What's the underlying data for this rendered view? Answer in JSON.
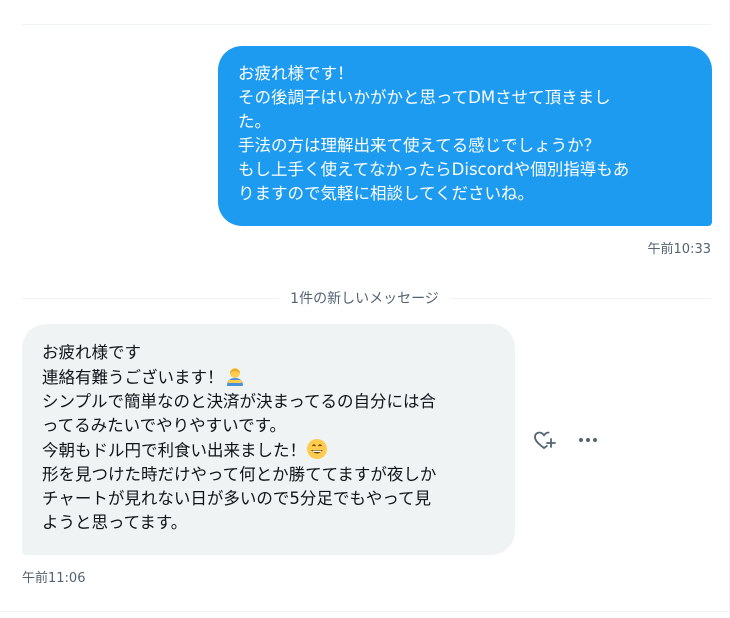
{
  "sent_message": {
    "lines": [
      "お疲れ様です！",
      "その後調子はいかがかと思ってDMさせて頂きまし",
      "た。",
      "手法の方は理解出来て使えてる感じでしょうか？",
      "もし上手く使えてなかったらDiscordや個別指導もあ",
      "りますので気軽に相談してくださいね。"
    ],
    "timestamp": "午前10:33"
  },
  "new_messages_label": "1件の新しいメッセージ",
  "received_message": {
    "line1": "お疲れ様です",
    "line2": "連絡有難うございます！",
    "line3": "シンプルで簡単なのと決済が決まってるの自分には合",
    "line4": "ってるみたいでやりやすいです。",
    "line5": "今朝もドル円で利食い出来ました！",
    "line6": "形を見つけた時だけやって何とか勝ててますが夜しか",
    "line7": "チャートが見れない日が多いので5分足でもやって見",
    "line8": "ようと思ってます。",
    "emoji1": "bowing-person-emoji",
    "emoji2": "grinning-face-emoji",
    "timestamp": "午前11:06"
  },
  "actions": {
    "react_icon": "heart-plus-icon",
    "more_icon": "more-horizontal-icon"
  },
  "colors": {
    "sent_bubble": "#1d9bf0",
    "received_bubble": "#eff3f4",
    "muted_text": "#536471"
  }
}
